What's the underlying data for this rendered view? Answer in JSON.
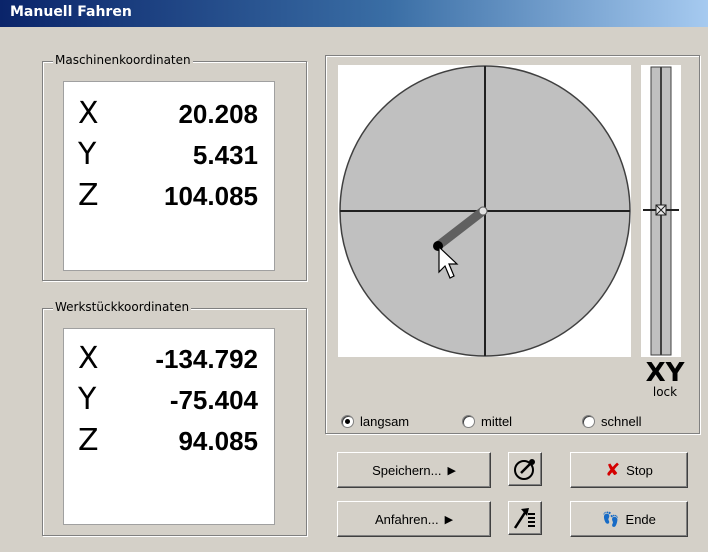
{
  "window": {
    "title": "Manuell Fahren"
  },
  "machine": {
    "legend": "Maschinenkoordinaten",
    "rows": [
      {
        "axis": "X",
        "value": "20.208"
      },
      {
        "axis": "Y",
        "value": "5.431"
      },
      {
        "axis": "Z",
        "value": "104.085"
      }
    ]
  },
  "workpiece": {
    "legend": "Werkstückkoordinaten",
    "rows": [
      {
        "axis": "X",
        "value": "-134.792"
      },
      {
        "axis": "Y",
        "value": "-75.404"
      },
      {
        "axis": "Z",
        "value": "94.085"
      }
    ]
  },
  "joystick": {
    "lock_main": "XY",
    "lock_sub": "lock",
    "colors": {
      "disc": "#c0c0c0",
      "stick": "#606060",
      "crosshair": "#202020"
    }
  },
  "speed": {
    "options": [
      {
        "label": "langsam",
        "checked": true
      },
      {
        "label": "mittel",
        "checked": false
      },
      {
        "label": "schnell",
        "checked": false
      }
    ]
  },
  "buttons": {
    "save": "Speichern...",
    "approach": "Anfahren...",
    "stop": "Stop",
    "end": "Ende"
  },
  "icons": {
    "compass": "compass-icon",
    "goto": "goto-arrow-icon",
    "stop": "red-x-icon",
    "end": "footprints-icon",
    "cursor": "mouse-pointer-icon"
  }
}
